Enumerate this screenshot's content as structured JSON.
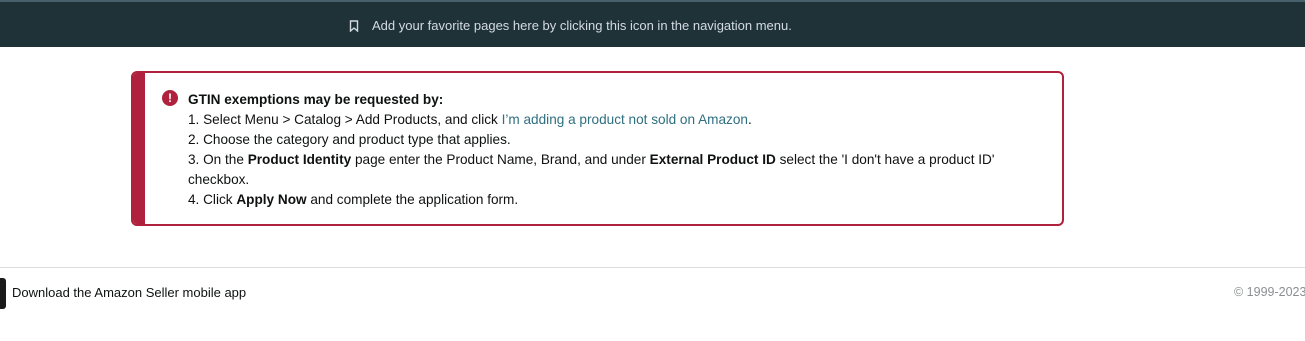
{
  "top_banner": {
    "icon": "bookmark-icon",
    "text": "Add your favorite pages here by clicking this icon in the navigation menu."
  },
  "alert": {
    "icon": "exclamation-circle-icon",
    "color": "#b0213d",
    "title": "GTIN exemptions may be requested by:",
    "step1_prefix": "1. Select Menu > Catalog > Add Products, and click ",
    "step1_link": "I’m adding a product not sold on Amazon",
    "step1_suffix": ".",
    "step2": "2. Choose the category and product type that applies.",
    "step3_a": "3. On the ",
    "step3_b": "Product Identity",
    "step3_c": " page enter the Product Name, Brand, and under ",
    "step3_d": "External Product ID",
    "step3_e": " select the 'I don't have a product ID' checkbox.",
    "step4_a": "4. Click ",
    "step4_b": "Apply Now",
    "step4_c": " and complete the application form."
  },
  "footer": {
    "app_link": "Download the Amazon Seller mobile app",
    "copyright": "© 1999-2023"
  }
}
